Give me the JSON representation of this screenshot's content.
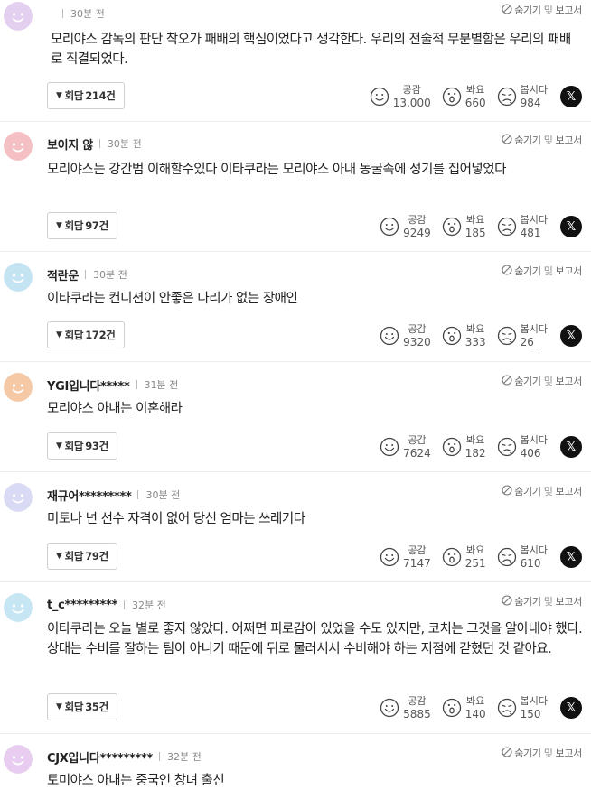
{
  "labels": {
    "hide": "숨기기",
    "and_word": "및",
    "report": "보고서",
    "reply": "회답",
    "reply_unit": "건",
    "like": "공감",
    "wow": "봐요",
    "sad": "봅시다",
    "x_icon_text": "𝕏"
  },
  "colors": {
    "avatar_purple": "#e3cff0",
    "avatar_pink": "#f4c0c4",
    "avatar_blue": "#c4e4f4",
    "avatar_orange": "#f5c9a5",
    "avatar_lavender": "#d9dbf5",
    "avatar_blue2": "#c6e6f3",
    "avatar_purple2": "#e8cdf0"
  },
  "comments": [
    {
      "avatar": "purple",
      "author": "",
      "time": "30분 전",
      "text": "모리야스 감독의 판단 착오가 패배의 핵심이었다고 생각한다. 우리의 전술적 무분별함은 우리의 패배로 직결되었다.",
      "replies": "214",
      "likes": "13,000",
      "wow": "660",
      "sad": "984"
    },
    {
      "avatar": "pink",
      "author": "보이지 않",
      "time": "30분 전",
      "text": "모리야스는 강간범 이해할수있다 이타쿠라는 모리야스 아내 동굴속에 성기를 집어넣었다",
      "replies": "97",
      "likes": "9249",
      "wow": "185",
      "sad": "481"
    },
    {
      "avatar": "blue",
      "author": "적란운",
      "time": "30분 전",
      "text": "이타쿠라는 컨디션이 안좋은 다리가 없는 장애인",
      "replies": "172",
      "likes": "9320",
      "wow": "333",
      "sad": "26_"
    },
    {
      "avatar": "orange",
      "author": "YGI입니다*****",
      "time": "31분 전",
      "text": "모리야스 아내는 이혼해라",
      "replies": "93",
      "likes": "7624",
      "wow": "182",
      "sad": "406"
    },
    {
      "avatar": "lavender",
      "author": "재규어*********",
      "time": "30분 전",
      "text": "미토나 넌 선수 자격이 없어 당신 엄마는 쓰레기다",
      "replies": "79",
      "likes": "7147",
      "wow": "251",
      "sad": "610"
    },
    {
      "avatar": "blue2",
      "author": "t_c*********",
      "time": "32분 전",
      "text": "이타쿠라는 오늘 별로 좋지 않았다. 어쩌면 피로감이 있었을 수도 있지만, 코치는 그것을 알아내야 했다. 상대는 수비를 잘하는 팀이 아니기 때문에 뒤로 물러서서 수비해야 하는 지점에 갇혔던 것 같아요.",
      "replies": "35",
      "likes": "5885",
      "wow": "140",
      "sad": "150"
    },
    {
      "avatar": "purple2",
      "author": "CJX입니다*********",
      "time": "32분 전",
      "text": "토미야스 아내는 중국인 창녀 출신",
      "replies": "",
      "likes": "",
      "wow": "",
      "sad": ""
    }
  ]
}
